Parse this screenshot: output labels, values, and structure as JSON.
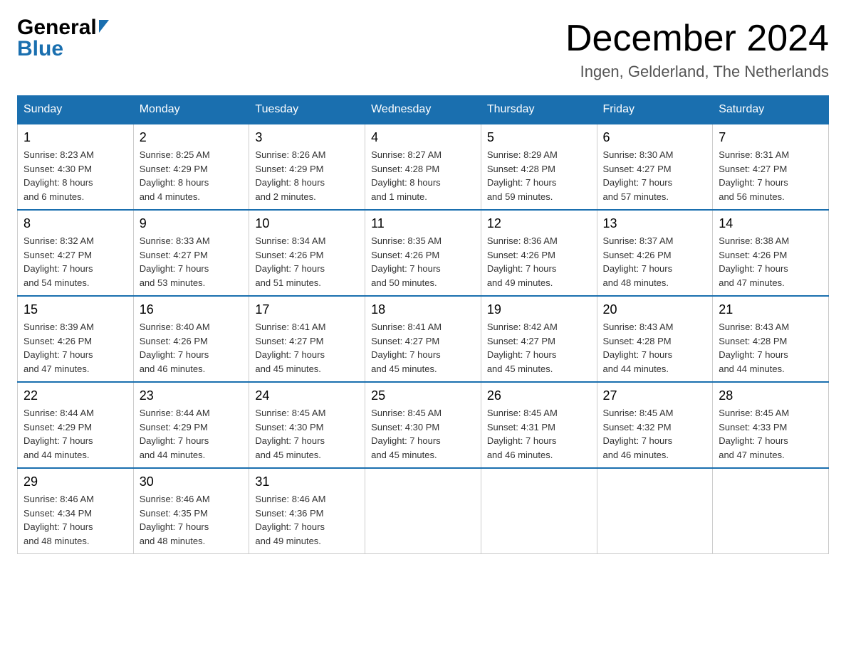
{
  "header": {
    "month_title": "December 2024",
    "location": "Ingen, Gelderland, The Netherlands",
    "logo_general": "General",
    "logo_blue": "Blue"
  },
  "days_of_week": [
    "Sunday",
    "Monday",
    "Tuesday",
    "Wednesday",
    "Thursday",
    "Friday",
    "Saturday"
  ],
  "weeks": [
    [
      {
        "day": "1",
        "sunrise": "Sunrise: 8:23 AM",
        "sunset": "Sunset: 4:30 PM",
        "daylight": "Daylight: 8 hours",
        "daylight2": "and 6 minutes."
      },
      {
        "day": "2",
        "sunrise": "Sunrise: 8:25 AM",
        "sunset": "Sunset: 4:29 PM",
        "daylight": "Daylight: 8 hours",
        "daylight2": "and 4 minutes."
      },
      {
        "day": "3",
        "sunrise": "Sunrise: 8:26 AM",
        "sunset": "Sunset: 4:29 PM",
        "daylight": "Daylight: 8 hours",
        "daylight2": "and 2 minutes."
      },
      {
        "day": "4",
        "sunrise": "Sunrise: 8:27 AM",
        "sunset": "Sunset: 4:28 PM",
        "daylight": "Daylight: 8 hours",
        "daylight2": "and 1 minute."
      },
      {
        "day": "5",
        "sunrise": "Sunrise: 8:29 AM",
        "sunset": "Sunset: 4:28 PM",
        "daylight": "Daylight: 7 hours",
        "daylight2": "and 59 minutes."
      },
      {
        "day": "6",
        "sunrise": "Sunrise: 8:30 AM",
        "sunset": "Sunset: 4:27 PM",
        "daylight": "Daylight: 7 hours",
        "daylight2": "and 57 minutes."
      },
      {
        "day": "7",
        "sunrise": "Sunrise: 8:31 AM",
        "sunset": "Sunset: 4:27 PM",
        "daylight": "Daylight: 7 hours",
        "daylight2": "and 56 minutes."
      }
    ],
    [
      {
        "day": "8",
        "sunrise": "Sunrise: 8:32 AM",
        "sunset": "Sunset: 4:27 PM",
        "daylight": "Daylight: 7 hours",
        "daylight2": "and 54 minutes."
      },
      {
        "day": "9",
        "sunrise": "Sunrise: 8:33 AM",
        "sunset": "Sunset: 4:27 PM",
        "daylight": "Daylight: 7 hours",
        "daylight2": "and 53 minutes."
      },
      {
        "day": "10",
        "sunrise": "Sunrise: 8:34 AM",
        "sunset": "Sunset: 4:26 PM",
        "daylight": "Daylight: 7 hours",
        "daylight2": "and 51 minutes."
      },
      {
        "day": "11",
        "sunrise": "Sunrise: 8:35 AM",
        "sunset": "Sunset: 4:26 PM",
        "daylight": "Daylight: 7 hours",
        "daylight2": "and 50 minutes."
      },
      {
        "day": "12",
        "sunrise": "Sunrise: 8:36 AM",
        "sunset": "Sunset: 4:26 PM",
        "daylight": "Daylight: 7 hours",
        "daylight2": "and 49 minutes."
      },
      {
        "day": "13",
        "sunrise": "Sunrise: 8:37 AM",
        "sunset": "Sunset: 4:26 PM",
        "daylight": "Daylight: 7 hours",
        "daylight2": "and 48 minutes."
      },
      {
        "day": "14",
        "sunrise": "Sunrise: 8:38 AM",
        "sunset": "Sunset: 4:26 PM",
        "daylight": "Daylight: 7 hours",
        "daylight2": "and 47 minutes."
      }
    ],
    [
      {
        "day": "15",
        "sunrise": "Sunrise: 8:39 AM",
        "sunset": "Sunset: 4:26 PM",
        "daylight": "Daylight: 7 hours",
        "daylight2": "and 47 minutes."
      },
      {
        "day": "16",
        "sunrise": "Sunrise: 8:40 AM",
        "sunset": "Sunset: 4:26 PM",
        "daylight": "Daylight: 7 hours",
        "daylight2": "and 46 minutes."
      },
      {
        "day": "17",
        "sunrise": "Sunrise: 8:41 AM",
        "sunset": "Sunset: 4:27 PM",
        "daylight": "Daylight: 7 hours",
        "daylight2": "and 45 minutes."
      },
      {
        "day": "18",
        "sunrise": "Sunrise: 8:41 AM",
        "sunset": "Sunset: 4:27 PM",
        "daylight": "Daylight: 7 hours",
        "daylight2": "and 45 minutes."
      },
      {
        "day": "19",
        "sunrise": "Sunrise: 8:42 AM",
        "sunset": "Sunset: 4:27 PM",
        "daylight": "Daylight: 7 hours",
        "daylight2": "and 45 minutes."
      },
      {
        "day": "20",
        "sunrise": "Sunrise: 8:43 AM",
        "sunset": "Sunset: 4:28 PM",
        "daylight": "Daylight: 7 hours",
        "daylight2": "and 44 minutes."
      },
      {
        "day": "21",
        "sunrise": "Sunrise: 8:43 AM",
        "sunset": "Sunset: 4:28 PM",
        "daylight": "Daylight: 7 hours",
        "daylight2": "and 44 minutes."
      }
    ],
    [
      {
        "day": "22",
        "sunrise": "Sunrise: 8:44 AM",
        "sunset": "Sunset: 4:29 PM",
        "daylight": "Daylight: 7 hours",
        "daylight2": "and 44 minutes."
      },
      {
        "day": "23",
        "sunrise": "Sunrise: 8:44 AM",
        "sunset": "Sunset: 4:29 PM",
        "daylight": "Daylight: 7 hours",
        "daylight2": "and 44 minutes."
      },
      {
        "day": "24",
        "sunrise": "Sunrise: 8:45 AM",
        "sunset": "Sunset: 4:30 PM",
        "daylight": "Daylight: 7 hours",
        "daylight2": "and 45 minutes."
      },
      {
        "day": "25",
        "sunrise": "Sunrise: 8:45 AM",
        "sunset": "Sunset: 4:30 PM",
        "daylight": "Daylight: 7 hours",
        "daylight2": "and 45 minutes."
      },
      {
        "day": "26",
        "sunrise": "Sunrise: 8:45 AM",
        "sunset": "Sunset: 4:31 PM",
        "daylight": "Daylight: 7 hours",
        "daylight2": "and 46 minutes."
      },
      {
        "day": "27",
        "sunrise": "Sunrise: 8:45 AM",
        "sunset": "Sunset: 4:32 PM",
        "daylight": "Daylight: 7 hours",
        "daylight2": "and 46 minutes."
      },
      {
        "day": "28",
        "sunrise": "Sunrise: 8:45 AM",
        "sunset": "Sunset: 4:33 PM",
        "daylight": "Daylight: 7 hours",
        "daylight2": "and 47 minutes."
      }
    ],
    [
      {
        "day": "29",
        "sunrise": "Sunrise: 8:46 AM",
        "sunset": "Sunset: 4:34 PM",
        "daylight": "Daylight: 7 hours",
        "daylight2": "and 48 minutes."
      },
      {
        "day": "30",
        "sunrise": "Sunrise: 8:46 AM",
        "sunset": "Sunset: 4:35 PM",
        "daylight": "Daylight: 7 hours",
        "daylight2": "and 48 minutes."
      },
      {
        "day": "31",
        "sunrise": "Sunrise: 8:46 AM",
        "sunset": "Sunset: 4:36 PM",
        "daylight": "Daylight: 7 hours",
        "daylight2": "and 49 minutes."
      },
      null,
      null,
      null,
      null
    ]
  ]
}
